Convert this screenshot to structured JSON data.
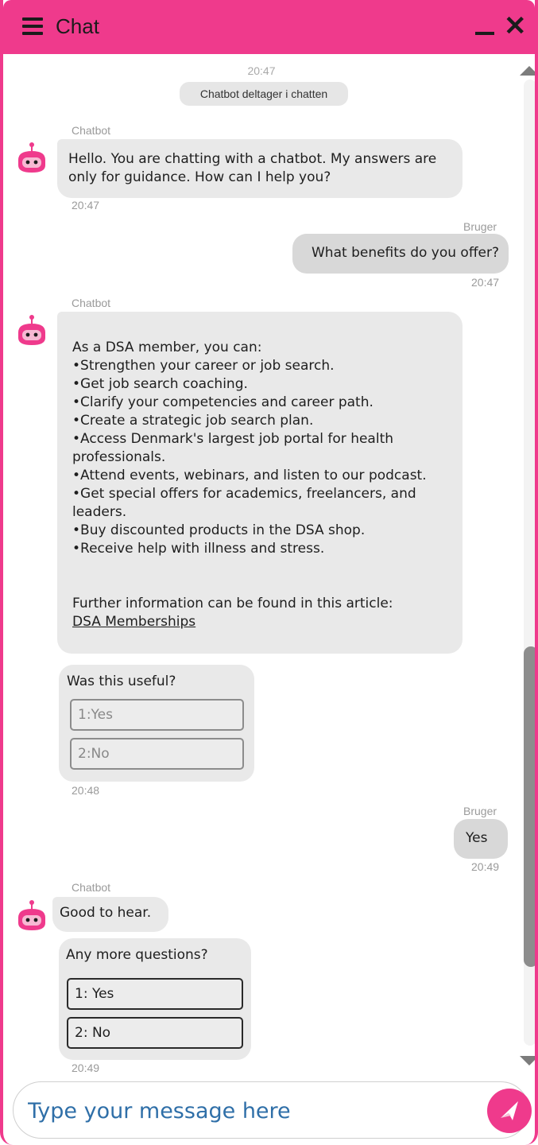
{
  "header": {
    "title": "Chat",
    "minimize_label": "_",
    "close_label": "✕"
  },
  "system": {
    "time": "20:47",
    "notice": "Chatbot deltager i chatten"
  },
  "messages": [
    {
      "sender": "Chatbot",
      "text": "Hello. You are chatting with a chatbot. My answers are only for guidance. How can I help you?",
      "time": "20:47"
    },
    {
      "sender": "Bruger",
      "text": "What benefits do you offer?",
      "time": "20:47"
    },
    {
      "sender": "Chatbot",
      "lines": [
        "As a DSA member, you can:",
        "•Strengthen your career or job search.",
        "•Get job search coaching.",
        "•Clarify your competencies and career path.",
        "•Create a strategic job search plan.",
        "•Access Denmark's largest job portal for health professionals.",
        "•Attend events, webinars, and listen to our podcast.",
        "•Get special offers for academics, freelancers, and leaders.",
        "•Buy discounted products in the DSA shop.",
        "•Receive help with illness and stress."
      ],
      "footer": "Further information can be found in this article:",
      "link": "DSA Memberships"
    },
    {
      "prompt": "Was this useful?",
      "options": [
        "1:Yes",
        "2:No"
      ],
      "time": "20:48"
    },
    {
      "sender": "Bruger",
      "text": "Yes",
      "time": "20:49"
    },
    {
      "sender": "Chatbot",
      "text": "Good to hear."
    },
    {
      "prompt": "Any more questions?",
      "options": [
        "1: Yes",
        "2: No"
      ],
      "time": "20:49"
    }
  ],
  "input": {
    "placeholder": "Type your message here"
  },
  "colors": {
    "brand": "#ef3a8c",
    "bubble_bot": "#e9e9e9",
    "bubble_user": "#d8d8d8"
  }
}
